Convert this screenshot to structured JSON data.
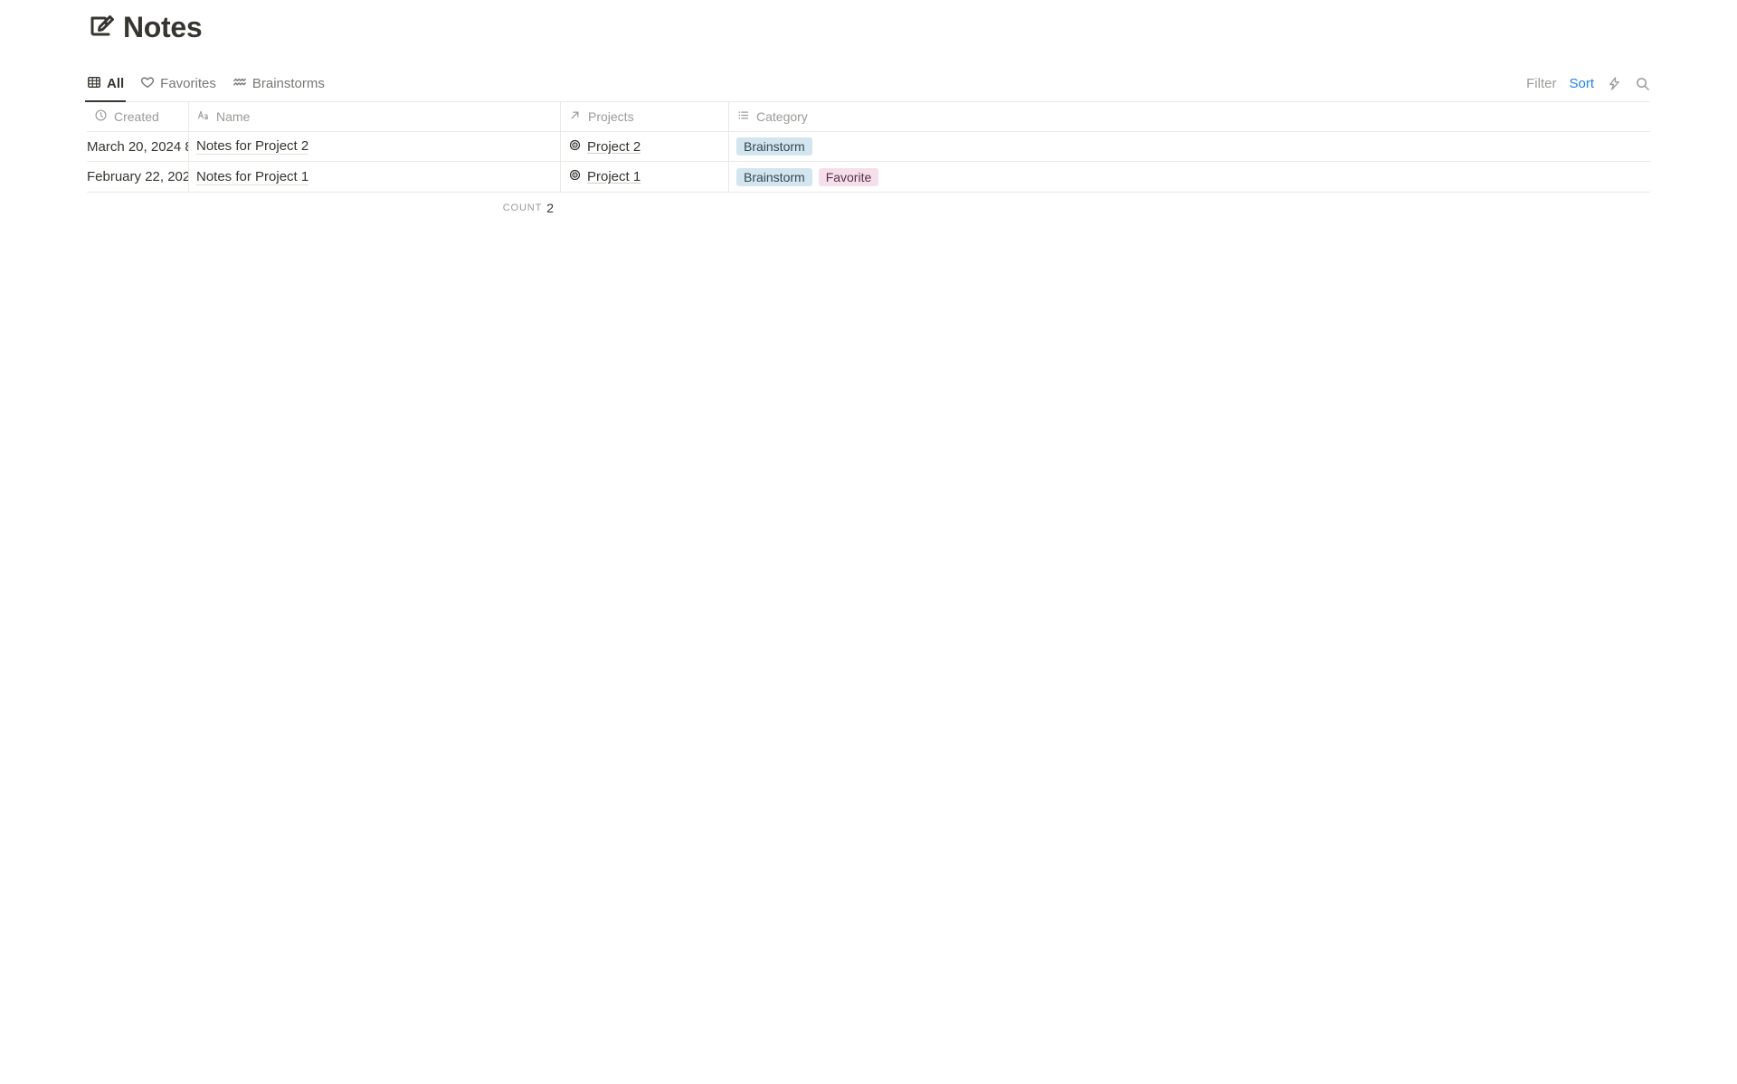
{
  "title": "Notes",
  "tabs": [
    {
      "label": "All",
      "icon": "table"
    },
    {
      "label": "Favorites",
      "icon": "heart"
    },
    {
      "label": "Brainstorms",
      "icon": "aquarius"
    }
  ],
  "actions": {
    "filter": "Filter",
    "sort": "Sort"
  },
  "columns": {
    "created": "Created",
    "name": "Name",
    "projects": "Projects",
    "category": "Category"
  },
  "rows": [
    {
      "created": "March 20, 2024 8",
      "name": "Notes for Project 2",
      "project": "Project 2",
      "tags": [
        {
          "text": "Brainstorm",
          "color": "blue"
        }
      ]
    },
    {
      "created": "February 22, 202",
      "name": "Notes for Project 1",
      "project": "Project 1",
      "tags": [
        {
          "text": "Brainstorm",
          "color": "blue"
        },
        {
          "text": "Favorite",
          "color": "pink"
        }
      ]
    }
  ],
  "footer": {
    "label": "Count",
    "count": "2"
  }
}
